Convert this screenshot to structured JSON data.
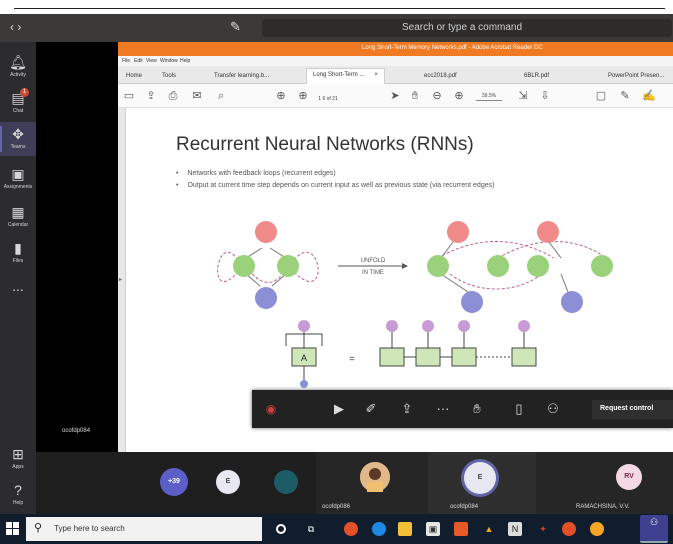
{
  "titlebar": {
    "search_text": "Search or type a command"
  },
  "rail": {
    "items": [
      {
        "label": "Activity",
        "icon": "bell-icon"
      },
      {
        "label": "Chat",
        "icon": "chat-icon",
        "badge": "1"
      },
      {
        "label": "Teams",
        "icon": "teams-icon"
      },
      {
        "label": "Assignments",
        "icon": "assignments-icon"
      },
      {
        "label": "Calendar",
        "icon": "calendar-icon"
      },
      {
        "label": "Files",
        "icon": "files-icon"
      },
      {
        "label": "...",
        "icon": "more-icon"
      }
    ],
    "bottom_items": [
      {
        "label": "Apps",
        "icon": "apps-icon"
      },
      {
        "label": "Help",
        "icon": "help-icon"
      }
    ]
  },
  "presenter": {
    "name": "ocofdp084"
  },
  "acrobat": {
    "title": "Long Short-Term Memory Networks.pdf - Adobe Acrobat Reader DC",
    "menu": [
      "File",
      "Edit",
      "View",
      "Window",
      "Help"
    ],
    "tabs": [
      {
        "label": "Home"
      },
      {
        "label": "Tools"
      },
      {
        "label": "Transfer learning.b..."
      },
      {
        "label": "Long Short-Term ...",
        "active": true,
        "closable": "×"
      },
      {
        "label": "ecc2018.pdf"
      },
      {
        "label": "6BLR.pdf"
      },
      {
        "label": "PowerPoint Presen..."
      }
    ],
    "toolbar": {
      "page_current": "1",
      "page_total": "6 of 21",
      "zoom": "39.5%"
    }
  },
  "slide": {
    "title": "Recurrent Neural Networks (RNNs)",
    "bullets": [
      "Networks with feedback loops (recurrent edges)",
      "Output at current time step depends on current input as well as previous state (via recurrent edges)"
    ],
    "unfold_label": "UNFOLD",
    "unfold_sub": "IN TIME",
    "cell_label": "A",
    "output_label": "h",
    "equals": "="
  },
  "controls": {
    "timer": "",
    "request_control": "Request control"
  },
  "participants": {
    "overflow": "+39",
    "tiles": [
      {
        "initial": "E",
        "color": "#e8e8f3"
      },
      {
        "initial": "",
        "color": "#1b5c66"
      }
    ],
    "named": [
      {
        "name": "ocofdp086"
      },
      {
        "name": "ocofdp084",
        "initial": "E"
      },
      {
        "name": "RAMACHSINA, V.V.",
        "initial": "RV"
      }
    ]
  },
  "taskbar": {
    "search_placeholder": "Type here to search"
  }
}
